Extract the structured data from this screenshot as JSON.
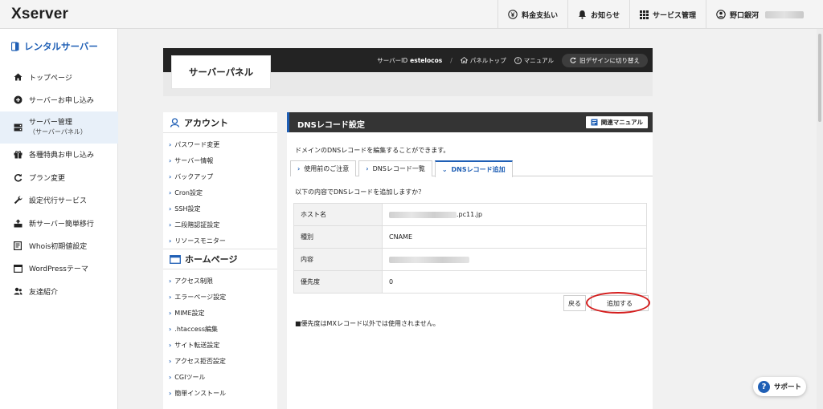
{
  "header": {
    "logo": "Xserver",
    "nav": [
      {
        "label": "料金支払い",
        "icon": "yen-icon"
      },
      {
        "label": "お知らせ",
        "icon": "bell-icon"
      },
      {
        "label": "サービス管理",
        "icon": "grid-icon"
      },
      {
        "label": "野口銀河",
        "icon": "user-icon"
      }
    ]
  },
  "sidebar": {
    "title": "レンタルサーバー",
    "items": [
      {
        "label": "トップページ",
        "icon": "home-icon"
      },
      {
        "label": "サーバーお申し込み",
        "icon": "plus-circle-icon"
      },
      {
        "label": "サーバー管理",
        "sub": "（サーバーパネル）",
        "icon": "server-icon",
        "active": true
      },
      {
        "label": "各種特典お申し込み",
        "icon": "gift-icon"
      },
      {
        "label": "プラン変更",
        "icon": "refresh-icon"
      },
      {
        "label": "設定代行サービス",
        "icon": "wrench-icon"
      },
      {
        "label": "新サーバー簡単移行",
        "icon": "migrate-icon"
      },
      {
        "label": "Whois初期値設定",
        "icon": "document-icon"
      },
      {
        "label": "WordPressテーマ",
        "icon": "window-icon"
      },
      {
        "label": "友達紹介",
        "icon": "friend-icon"
      }
    ]
  },
  "panel": {
    "title": "サーバーパネル",
    "server_id_label": "サーバーID",
    "server_id": "estelocos",
    "panel_top": "パネルトップ",
    "manual": "マニュアル",
    "old_design": "旧デザインに切り替え"
  },
  "left_menu": {
    "account": {
      "title": "アカウント",
      "items": [
        "パスワード変更",
        "サーバー情報",
        "バックアップ",
        "Cron設定",
        "SSH設定",
        "二段階認証設定",
        "リソースモニター"
      ]
    },
    "homepage": {
      "title": "ホームページ",
      "items": [
        "アクセス制限",
        "エラーページ設定",
        "MIME設定",
        ".htaccess編集",
        "サイト転送設定",
        "アクセス拒否設定",
        "CGIツール",
        "簡単インストール"
      ]
    }
  },
  "content": {
    "title": "DNSレコード設定",
    "manual_button": "関連マニュアル",
    "description": "ドメインのDNSレコードを編集することができます。",
    "tabs": [
      {
        "label": "使用前のご注意",
        "active": false
      },
      {
        "label": "DNSレコード一覧",
        "active": false
      },
      {
        "label": "DNSレコード追加",
        "active": true
      }
    ],
    "confirm_text": "以下の内容でDNSレコードを追加しますか？",
    "rows": [
      {
        "key": "ホスト名",
        "value": ".pc11.jp"
      },
      {
        "key": "種別",
        "value": "CNAME"
      },
      {
        "key": "内容",
        "value": ""
      },
      {
        "key": "優先度",
        "value": "0"
      }
    ],
    "back_button": "戻る",
    "add_button": "追加する",
    "note": "■優先度はMXレコード以外では使用されません。"
  },
  "support": {
    "label": "サポート"
  },
  "colors": {
    "accent": "#1f5fb5",
    "highlight_ring": "#d41d1d",
    "dark_header": "#232323"
  }
}
